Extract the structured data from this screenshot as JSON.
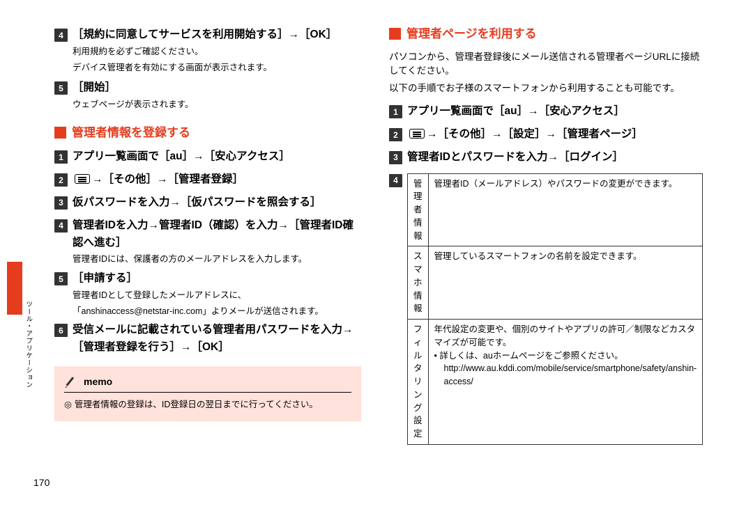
{
  "sidebar_label": "ツール・アプリケーション",
  "page_number": "170",
  "left": {
    "pre_steps": [
      {
        "n": "4",
        "title": "［規約に同意してサービスを利用開始する］→［OK］",
        "notes": [
          "利用規約を必ずご確認ください。",
          "デバイス管理者を有効にする画面が表示されます。"
        ]
      },
      {
        "n": "5",
        "title": "［開始］",
        "notes": [
          "ウェブページが表示されます。"
        ]
      }
    ],
    "section1_title": "管理者情報を登録する",
    "steps1": [
      {
        "n": "1",
        "title": "アプリ一覧画面で［au］→［安心アクセス］"
      },
      {
        "n": "2",
        "title_parts": [
          "",
          "→［その他］→［管理者登録］"
        ],
        "menu_glyph": true
      },
      {
        "n": "3",
        "title": "仮パスワードを入力→［仮パスワードを照会する］"
      },
      {
        "n": "4",
        "title": "管理者IDを入力→管理者ID（確認）を入力→［管理者ID確認へ進む］",
        "notes": [
          "管理者IDには、保護者の方のメールアドレスを入力します。"
        ]
      },
      {
        "n": "5",
        "title": "［申請する］",
        "notes": [
          "管理者IDとして登録したメールアドレスに、",
          "「anshinaccess@netstar-inc.com」よりメールが送信されます。"
        ]
      },
      {
        "n": "6",
        "title": "受信メールに記載されている管理者用パスワードを入力→［管理者登録を行う］→［OK］"
      }
    ],
    "memo_label": "memo",
    "memo_body": "管理者情報の登録は、ID登録日の翌日までに行ってください。",
    "memo_mark": "◎"
  },
  "right": {
    "section2_title": "管理者ページを利用する",
    "intro": [
      "パソコンから、管理者登録後にメール送信される管理者ページURLに接続してください。",
      "以下の手順でお子様のスマートフォンから利用することも可能です。"
    ],
    "steps2": [
      {
        "n": "1",
        "title": "アプリ一覧画面で［au］→［安心アクセス］"
      },
      {
        "n": "2",
        "title_parts": [
          "",
          "→［その他］→［設定］→［管理者ページ］"
        ],
        "menu_glyph": true
      },
      {
        "n": "3",
        "title": "管理者IDとパスワードを入力→［ログイン］"
      }
    ],
    "table_badge": "4",
    "table": [
      {
        "label": "管理者情報",
        "desc": "管理者ID（メールアドレス）やパスワードの変更ができます。"
      },
      {
        "label": "スマホ情報",
        "desc": "管理しているスマートフォンの名前を設定できます。"
      },
      {
        "label": "フィルタリング設定",
        "desc_lines": [
          "年代設定の変更や、個別のサイトやアプリの許可／制限などカスタマイズが可能です。",
          "• 詳しくは、auホームページをご参照ください。",
          "http://www.au.kddi.com/mobile/service/smartphone/safety/anshin-access/"
        ]
      }
    ]
  }
}
